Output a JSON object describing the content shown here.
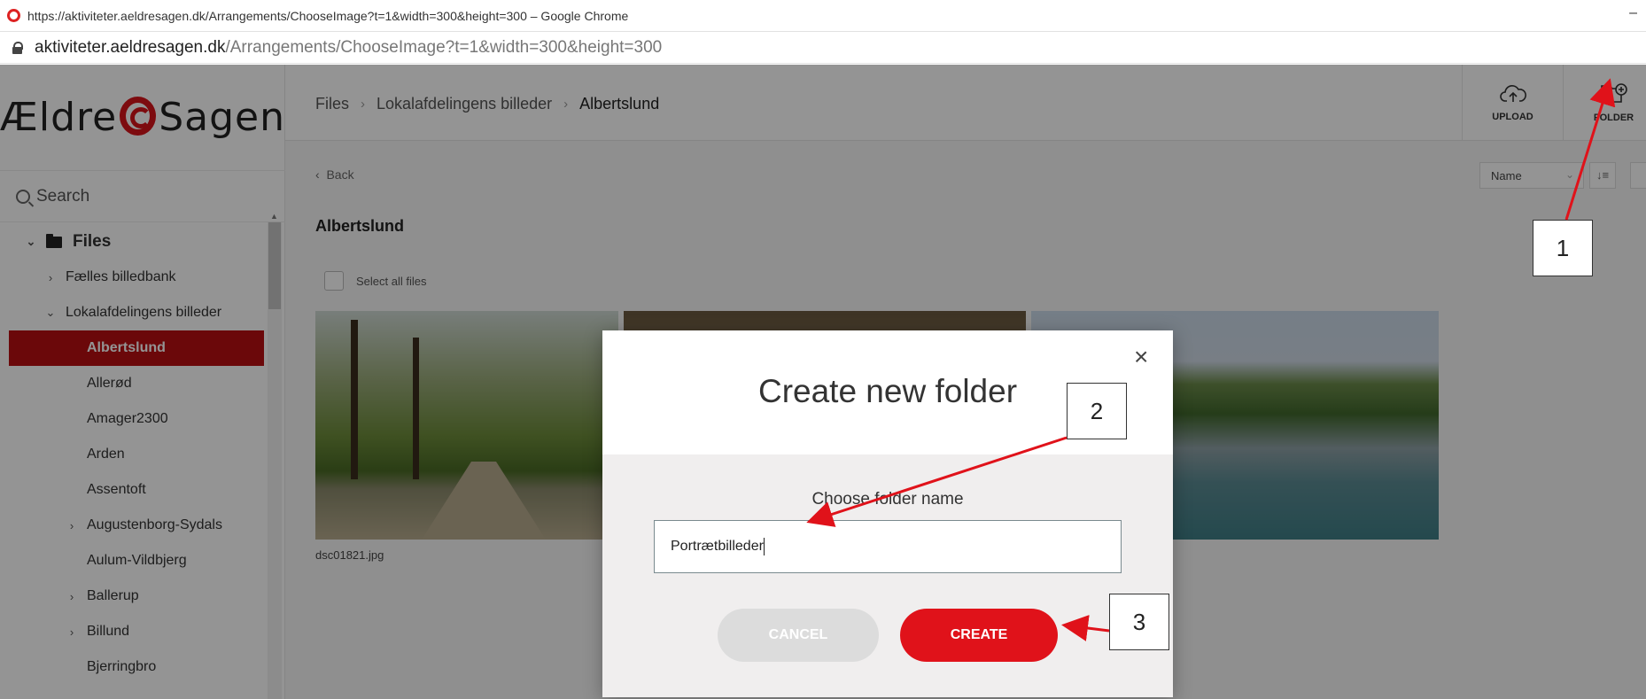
{
  "browser": {
    "window_title": "https://aktiviteter.aeldresagen.dk/Arrangements/ChooseImage?t=1&width=300&height=300 – Google Chrome",
    "minimize": "–",
    "host": "aktiviteter.aeldresagen.dk",
    "path": "/Arrangements/ChooseImage?t=1&width=300&height=300"
  },
  "logo": {
    "left": "Ældre",
    "right": "Sagen"
  },
  "search": {
    "label": "Search"
  },
  "tree": {
    "root": "Files",
    "items": [
      {
        "label": "Fælles billedbank",
        "chevron": "›"
      },
      {
        "label": "Lokalafdelingens billeder",
        "chevron": "⌄"
      },
      {
        "label": "Albertslund",
        "chevron": ""
      },
      {
        "label": "Allerød",
        "chevron": ""
      },
      {
        "label": "Amager2300",
        "chevron": ""
      },
      {
        "label": "Arden",
        "chevron": ""
      },
      {
        "label": "Assentoft",
        "chevron": ""
      },
      {
        "label": "Augustenborg-Sydals",
        "chevron": "›"
      },
      {
        "label": "Aulum-Vildbjerg",
        "chevron": ""
      },
      {
        "label": "Ballerup",
        "chevron": "›"
      },
      {
        "label": "Billund",
        "chevron": "›"
      },
      {
        "label": "Bjerringbro",
        "chevron": ""
      }
    ]
  },
  "breadcrumb": {
    "items": [
      "Files",
      "Lokalafdelingens billeder",
      "Albertslund"
    ],
    "sep": "›"
  },
  "toolbar": {
    "upload": "UPLOAD",
    "folder": "FOLDER"
  },
  "back_label": "Back",
  "sort": {
    "value": "Name",
    "order_icon": "↓≡"
  },
  "page_title": "Albertslund",
  "select_all": "Select all files",
  "files": [
    {
      "name": "dsc01821.jpg"
    }
  ],
  "dialog": {
    "title": "Create new folder",
    "close": "×",
    "label": "Choose folder name",
    "input_value": "Portrætbilleder",
    "cancel": "CANCEL",
    "create": "CREATE"
  },
  "annotations": {
    "one": "1",
    "two": "2",
    "three": "3",
    "arrow_color": "#e0121a"
  }
}
